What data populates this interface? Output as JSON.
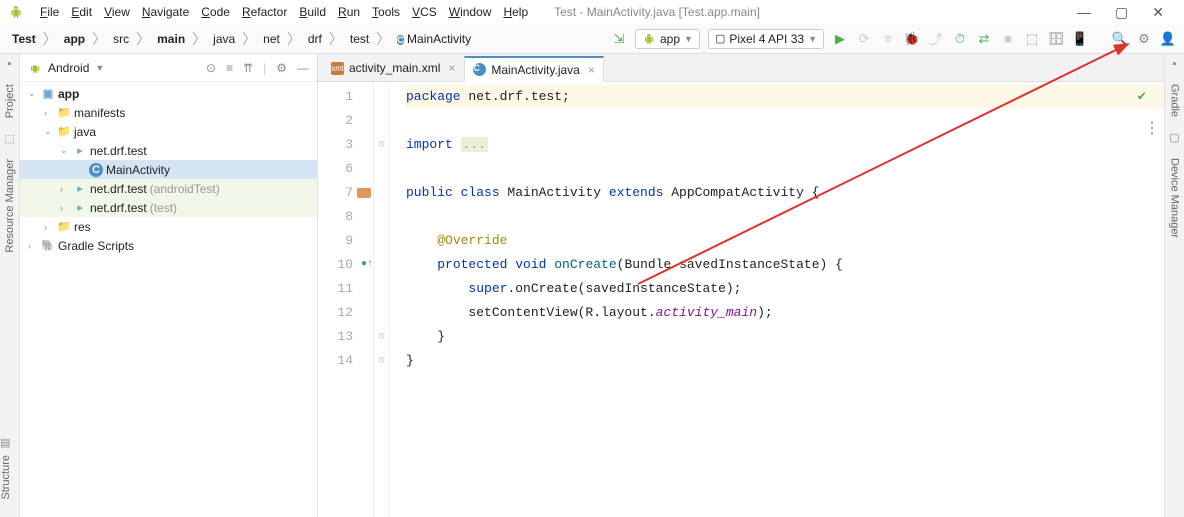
{
  "window": {
    "title": "Test - MainActivity.java [Test.app.main]"
  },
  "menu": [
    "File",
    "Edit",
    "View",
    "Navigate",
    "Code",
    "Refactor",
    "Build",
    "Run",
    "Tools",
    "VCS",
    "Window",
    "Help"
  ],
  "breadcrumb": [
    "Test",
    "app",
    "src",
    "main",
    "java",
    "net",
    "drf",
    "test",
    "MainActivity"
  ],
  "run": {
    "config": "app",
    "device": "Pixel 4 API 33"
  },
  "project": {
    "view": "Android",
    "tree": [
      {
        "depth": 0,
        "arrow": "v",
        "icon": "app",
        "label": "app",
        "bold": true,
        "hl": false
      },
      {
        "depth": 1,
        "arrow": ">",
        "icon": "folder",
        "label": "manifests",
        "hl": false
      },
      {
        "depth": 1,
        "arrow": "v",
        "icon": "folder",
        "label": "java",
        "hl": false
      },
      {
        "depth": 2,
        "arrow": "v",
        "icon": "pkg",
        "label": "net.drf.test",
        "hl": false
      },
      {
        "depth": 3,
        "arrow": "",
        "icon": "class",
        "label": "MainActivity",
        "sel": true
      },
      {
        "depth": 2,
        "arrow": ">",
        "icon": "pkg",
        "label": "net.drf.test",
        "suffix": "(androidTest)",
        "hl": true
      },
      {
        "depth": 2,
        "arrow": ">",
        "icon": "pkg",
        "label": "net.drf.test",
        "suffix": "(test)",
        "hl": true
      },
      {
        "depth": 1,
        "arrow": ">",
        "icon": "folder",
        "label": "res",
        "hl": false
      },
      {
        "depth": 0,
        "arrow": ">",
        "icon": "gradle",
        "label": "Gradle Scripts",
        "hl": false
      }
    ]
  },
  "tabs": [
    {
      "icon": "xml",
      "label": "activity_main.xml",
      "active": false
    },
    {
      "icon": "class",
      "label": "MainActivity.java",
      "active": true
    }
  ],
  "code": {
    "lines": [
      {
        "n": 1,
        "bg": true,
        "html": "<span class='kw'>package</span> net.drf.test;"
      },
      {
        "n": 2,
        "html": ""
      },
      {
        "n": 3,
        "fold": true,
        "html": "<span class='kw'>import</span> <span class='gray'>...</span>"
      },
      {
        "n": 6,
        "html": ""
      },
      {
        "n": 7,
        "warn": true,
        "html": "<span class='kw'>public class</span> MainActivity <span class='kw'>extends</span> AppCompatActivity {"
      },
      {
        "n": 8,
        "html": ""
      },
      {
        "n": 9,
        "html": "    <span class='ann'>@Override</span>"
      },
      {
        "n": 10,
        "override": true,
        "html": "    <span class='kw'>protected void</span> <span class='mtd'>onCreate</span>(Bundle savedInstanceState) {"
      },
      {
        "n": 11,
        "html": "        <span class='kw'>super</span>.onCreate(savedInstanceState);"
      },
      {
        "n": 12,
        "html": "        setContentView(R.layout.<span class='ital'>activity_main</span>);"
      },
      {
        "n": 13,
        "fold": true,
        "html": "    }"
      },
      {
        "n": 14,
        "fold": true,
        "html": "}"
      }
    ]
  },
  "left_tools": [
    "Project",
    "Resource Manager"
  ],
  "left_bottom": "Structure",
  "right_tools": [
    "Gradle",
    "Device Manager"
  ]
}
